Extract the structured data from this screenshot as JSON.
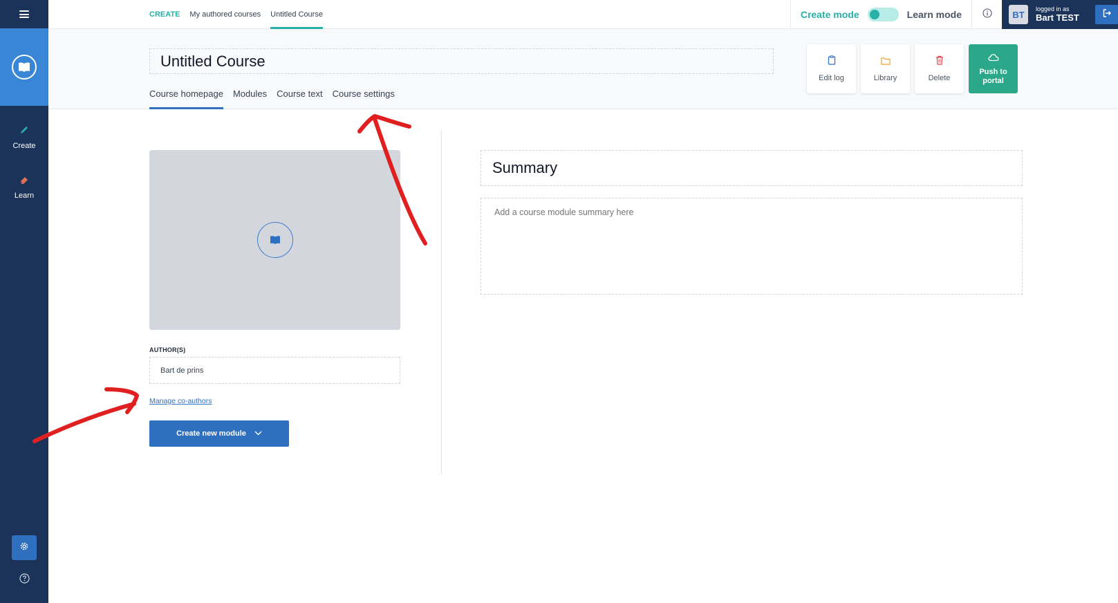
{
  "sidebar": {
    "menu_icon": "hamburger-icon",
    "logo_icon": "book-icon",
    "items": [
      {
        "label": "Create",
        "icon": "pencil-icon"
      },
      {
        "label": "Learn",
        "icon": "eraser-icon"
      }
    ],
    "settings_icon": "gear-icon",
    "help_icon": "question-circle-icon"
  },
  "topbar": {
    "breadcrumb": {
      "section": "CREATE",
      "link": "My authored courses",
      "current": "Untitled Course"
    },
    "mode": {
      "create_label": "Create mode",
      "learn_label": "Learn mode",
      "active": "create"
    },
    "info_icon": "info-circle-icon",
    "user": {
      "initials": "BT",
      "logged_in_label": "logged in as",
      "name": "Bart TEST"
    },
    "logout_icon": "logout-icon"
  },
  "course": {
    "title": "Untitled Course",
    "tabs": [
      {
        "label": "Course homepage",
        "active": true
      },
      {
        "label": "Modules",
        "active": false
      },
      {
        "label": "Course text",
        "active": false
      },
      {
        "label": "Course settings",
        "active": false
      }
    ]
  },
  "actions": [
    {
      "label": "Edit log",
      "icon": "clipboard-icon",
      "color": "#2f6fc0"
    },
    {
      "label": "Library",
      "icon": "folder-icon",
      "color": "#f0a030"
    },
    {
      "label": "Delete",
      "icon": "trash-icon",
      "color": "#e0484f"
    },
    {
      "label": "Push to portal",
      "icon": "cloud-icon",
      "color": "#ffffff"
    }
  ],
  "main": {
    "image_placeholder_icon": "book-icon",
    "authors_label": "AUTHOR(S)",
    "authors_value": "Bart de prins",
    "manage_coauthors": "Manage co-authors",
    "create_module": "Create new module",
    "summary_title": "Summary",
    "summary_placeholder": "Add a course module summary here"
  },
  "colors": {
    "sidebar": "#1b3358",
    "primary": "#2f6fc0",
    "accent_teal": "#26b0a7",
    "push_green": "#2aa889",
    "annotation_red": "#e02020"
  }
}
